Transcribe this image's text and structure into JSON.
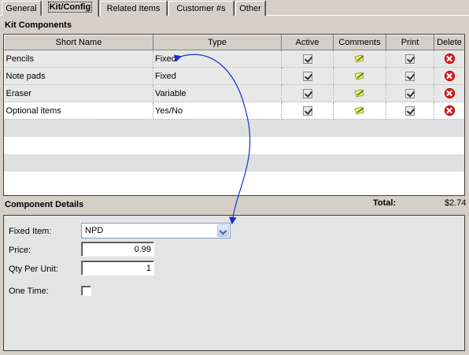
{
  "tabs": [
    {
      "label": "General",
      "active": false
    },
    {
      "label": "Kit/Config",
      "active": true
    },
    {
      "label": "Related Items",
      "active": false
    },
    {
      "label": "Customer #s",
      "active": false
    },
    {
      "label": "Other",
      "active": false
    }
  ],
  "kit_components": {
    "title": "Kit Components",
    "columns": [
      "Short Name",
      "Type",
      "Active",
      "Comments",
      "Print",
      "Delete"
    ],
    "rows": [
      {
        "short_name": "Pencils",
        "type": "Fixed",
        "active": true,
        "print": true
      },
      {
        "short_name": "Note pads",
        "type": "Fixed",
        "active": true,
        "print": true
      },
      {
        "short_name": "Eraser",
        "type": "Variable",
        "active": true,
        "print": true
      },
      {
        "short_name": "Optional items",
        "type": "Yes/No",
        "active": true,
        "print": true
      }
    ]
  },
  "total": {
    "label": "Total:",
    "value": "$2.74"
  },
  "component_details": {
    "title": "Component Details",
    "fixed_item_label": "Fixed Item:",
    "fixed_item_value": "NPD",
    "price_label": "Price:",
    "price_value": "0.99",
    "qty_label": "Qty Per Unit:",
    "qty_value": "1",
    "one_time_label": "One Time:",
    "one_time_checked": false
  },
  "icons": {
    "active": "checkmark-icon",
    "comments": "note-pencil-icon",
    "print": "checkmark-icon",
    "delete": "delete-x-icon",
    "dropdown": "chevron-down-icon"
  },
  "colors": {
    "annotation_arrow": "#1a2fd0",
    "delete": "#dd2222",
    "window": "#d4d0c8"
  }
}
